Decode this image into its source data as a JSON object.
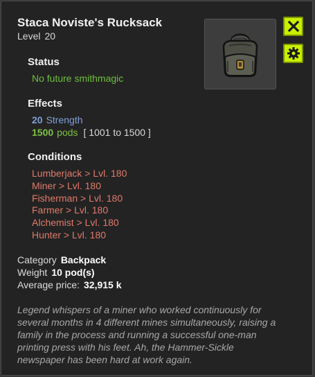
{
  "item": {
    "name": "Staca Noviste's Rucksack",
    "level_label": "Level",
    "level": "20",
    "image": "backpack"
  },
  "buttons": {
    "close_icon": "x-icon",
    "settings_icon": "gear-icon",
    "accent_color": "#c8f000"
  },
  "status": {
    "title": "Status",
    "text": "No future smithmagic"
  },
  "effects": {
    "title": "Effects",
    "items": [
      {
        "value": "20",
        "label": "Strength"
      },
      {
        "value": "1500",
        "label": "pods",
        "range": "[ 1001 to 1500 ]"
      }
    ]
  },
  "conditions": {
    "title": "Conditions",
    "items": [
      "Lumberjack > Lvl. 180",
      "Miner > Lvl. 180",
      "Fisherman > Lvl. 180",
      "Farmer > Lvl. 180",
      "Alchemist > Lvl. 180",
      "Hunter > Lvl. 180"
    ]
  },
  "meta": {
    "category_label": "Category",
    "category": "Backpack",
    "weight_label": "Weight",
    "weight": "10 pod(s)",
    "price_label": "Average price:",
    "price": "32,915 k"
  },
  "description": "Legend whispers of a miner who worked continuously for several months in 4 different mines simultaneously, raising a family in the process and running a successful one-man printing press with his feet. Ah, the Hammer-Sickle newspaper has been hard at work again."
}
